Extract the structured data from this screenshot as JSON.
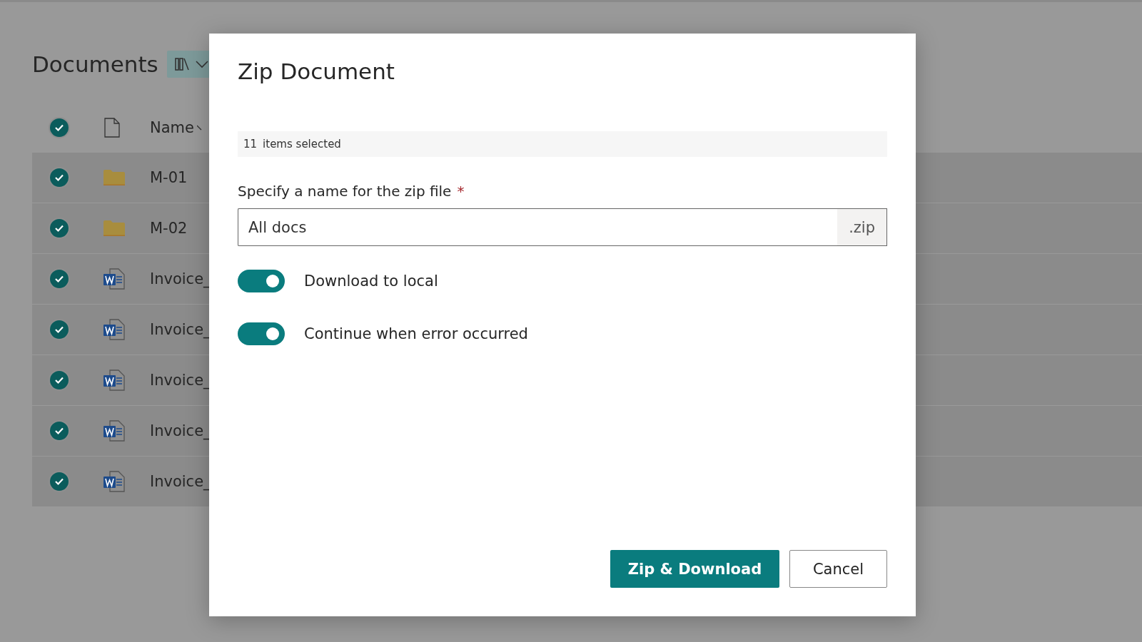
{
  "library": {
    "title": "Documents"
  },
  "list": {
    "header": {
      "selected": true,
      "name_column": "Name"
    },
    "rows": [
      {
        "kind": "folder",
        "name": "M-01",
        "selected": true
      },
      {
        "kind": "folder",
        "name": "M-02",
        "selected": true
      },
      {
        "kind": "word",
        "name": "Invoice_",
        "selected": true
      },
      {
        "kind": "word",
        "name": "Invoice_",
        "selected": true
      },
      {
        "kind": "word",
        "name": "Invoice_",
        "selected": true
      },
      {
        "kind": "word",
        "name": "Invoice_",
        "selected": true
      },
      {
        "kind": "word",
        "name": "Invoice_",
        "selected": true
      }
    ]
  },
  "dialog": {
    "title": "Zip Document",
    "selection_count": "11",
    "selection_text": "items selected",
    "field": {
      "label": "Specify a name for the zip file",
      "required_mark": "*",
      "value": "All docs",
      "suffix": ".zip"
    },
    "toggles": [
      {
        "label": "Download to local",
        "on": true
      },
      {
        "label": "Continue when error occurred",
        "on": true
      }
    ],
    "buttons": [
      {
        "kind": "primary",
        "label": "Zip & Download"
      },
      {
        "kind": "secondary",
        "label": "Cancel"
      }
    ]
  }
}
